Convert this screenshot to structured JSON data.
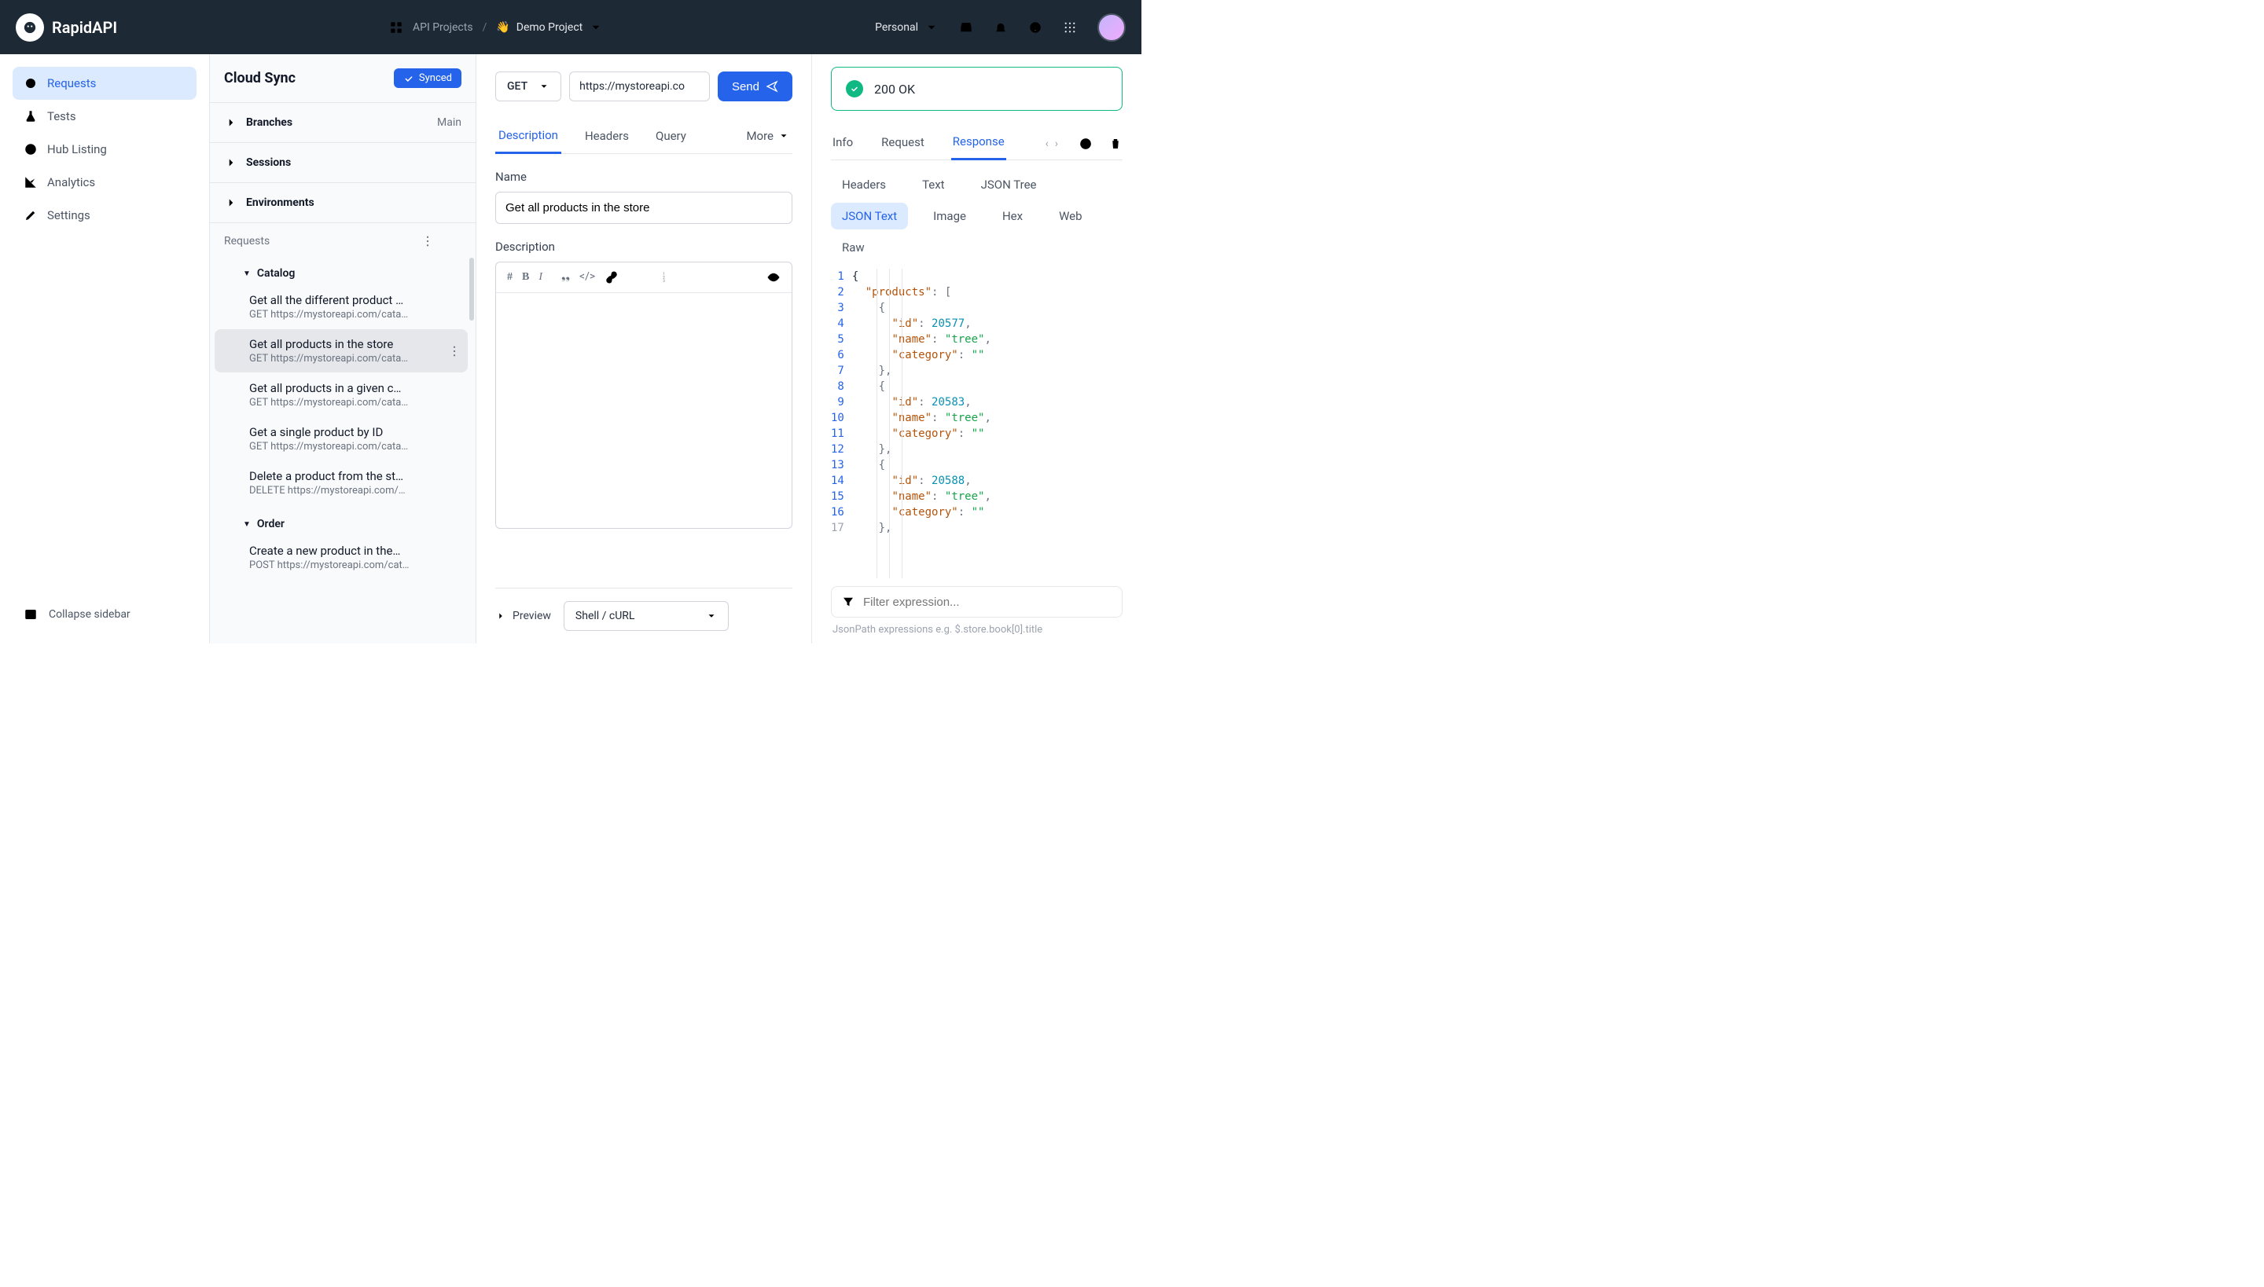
{
  "topbar": {
    "brand": "RapidAPI",
    "api_projects": "API Projects",
    "divider": "/",
    "project_name": "Demo Project",
    "project_emoji": "👋",
    "workspace": "Personal"
  },
  "sidebar": {
    "items": [
      {
        "label": "Requests"
      },
      {
        "label": "Tests"
      },
      {
        "label": "Hub Listing"
      },
      {
        "label": "Analytics"
      },
      {
        "label": "Settings"
      }
    ],
    "collapse": "Collapse sidebar"
  },
  "panel2": {
    "title": "Cloud Sync",
    "synced": "Synced",
    "sections": {
      "branches": {
        "label": "Branches",
        "trail": "Main"
      },
      "sessions": {
        "label": "Sessions"
      },
      "environments": {
        "label": "Environments"
      }
    },
    "requests_label": "Requests",
    "tree": {
      "group1": "Catalog",
      "items": [
        {
          "title": "Get all the different product …",
          "sub": "GET https://mystoreapi.com/cata…"
        },
        {
          "title": "Get all products in the store",
          "sub": "GET https://mystoreapi.com/cata…"
        },
        {
          "title": "Get all products in a given c…",
          "sub": "GET https://mystoreapi.com/cata…"
        },
        {
          "title": "Get a single product by ID",
          "sub": "GET https://mystoreapi.com/cata…"
        },
        {
          "title": "Delete a product from the st…",
          "sub": "DELETE https://mystoreapi.com/…"
        }
      ],
      "group2": "Order",
      "items2": [
        {
          "title": "Create a new product in the…",
          "sub": "POST https://mystoreapi.com/cat…"
        }
      ]
    }
  },
  "panel3": {
    "method": "GET",
    "url": "https://mystoreapi.co",
    "send": "Send",
    "tabs": {
      "description": "Description",
      "headers": "Headers",
      "query": "Query",
      "more": "More"
    },
    "name_label": "Name",
    "name_value": "Get all products in the store",
    "desc_label": "Description",
    "footer": {
      "preview": "Preview",
      "snippet": "Shell / cURL"
    }
  },
  "panel4": {
    "status": "200 OK",
    "tabs": {
      "info": "Info",
      "request": "Request",
      "response": "Response"
    },
    "views": {
      "headers": "Headers",
      "text": "Text",
      "jsontree": "JSON Tree",
      "jsontext": "JSON Text",
      "image": "Image",
      "hex": "Hex",
      "web": "Web",
      "raw": "Raw"
    },
    "filter_placeholder": "Filter expression...",
    "filter_hint": "JsonPath expressions e.g. $.store.book[0].title",
    "json_lines": [
      {
        "n": "1",
        "html": "{"
      },
      {
        "n": "2",
        "html": "  <span class='k'>\"products\"</span><span class='p'>:</span> <span class='p'>[</span>"
      },
      {
        "n": "3",
        "html": "    <span class='p'>{</span>"
      },
      {
        "n": "4",
        "html": "      <span class='k'>\"id\"</span><span class='p'>:</span> <span class='n'>20577</span><span class='p'>,</span>"
      },
      {
        "n": "5",
        "html": "      <span class='k'>\"name\"</span><span class='p'>:</span> <span class='s'>\"tree\"</span><span class='p'>,</span>"
      },
      {
        "n": "6",
        "html": "      <span class='k'>\"category\"</span><span class='p'>:</span> <span class='s'>\"\"</span>"
      },
      {
        "n": "7",
        "html": "    <span class='p'>},</span>"
      },
      {
        "n": "8",
        "html": "    <span class='p'>{</span>"
      },
      {
        "n": "9",
        "html": "      <span class='k'>\"id\"</span><span class='p'>:</span> <span class='n'>20583</span><span class='p'>,</span>"
      },
      {
        "n": "10",
        "html": "      <span class='k'>\"name\"</span><span class='p'>:</span> <span class='s'>\"tree\"</span><span class='p'>,</span>"
      },
      {
        "n": "11",
        "html": "      <span class='k'>\"category\"</span><span class='p'>:</span> <span class='s'>\"\"</span>"
      },
      {
        "n": "12",
        "html": "    <span class='p'>},</span>"
      },
      {
        "n": "13",
        "html": "    <span class='p'>{</span>"
      },
      {
        "n": "14",
        "html": "      <span class='k'>\"id\"</span><span class='p'>:</span> <span class='n'>20588</span><span class='p'>,</span>"
      },
      {
        "n": "15",
        "html": "      <span class='k'>\"name\"</span><span class='p'>:</span> <span class='s'>\"tree\"</span><span class='p'>,</span>"
      },
      {
        "n": "16",
        "html": "      <span class='k'>\"category\"</span><span class='p'>:</span> <span class='s'>\"\"</span>"
      },
      {
        "n": "17",
        "html": "    <span class='p'>},</span>",
        "faded": true
      }
    ]
  }
}
